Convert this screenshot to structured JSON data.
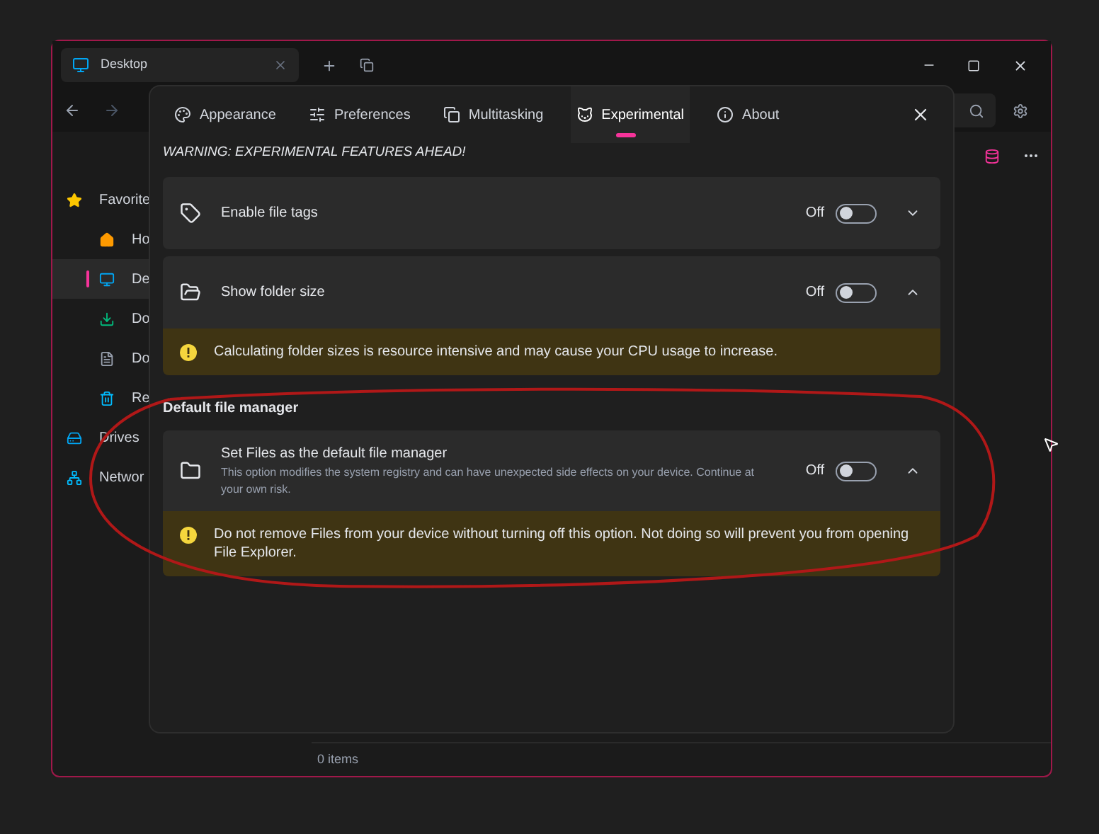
{
  "explorer": {
    "tab": {
      "title": "Desktop"
    },
    "sidebar": {
      "items": [
        {
          "label": "Favorite",
          "selected": false,
          "children": [
            {
              "label": "Ho",
              "selected": false
            },
            {
              "label": "De",
              "selected": true
            },
            {
              "label": "Do",
              "selected": false
            },
            {
              "label": "Do",
              "selected": false
            },
            {
              "label": "Re",
              "selected": false
            }
          ]
        },
        {
          "label": "Drives",
          "selected": false
        },
        {
          "label": "Networ",
          "selected": false
        }
      ]
    },
    "status_bar": "0 items"
  },
  "dialog": {
    "tabs": [
      {
        "label": "Appearance",
        "selected": false
      },
      {
        "label": "Preferences",
        "selected": false
      },
      {
        "label": "Multitasking",
        "selected": false
      },
      {
        "label": "Experimental",
        "selected": true
      },
      {
        "label": "About",
        "selected": false
      }
    ],
    "warning": "WARNING: EXPERIMENTAL FEATURES AHEAD!",
    "sections": [
      {
        "items": [
          {
            "title": "Enable file tags",
            "state_label": "Off",
            "on": false,
            "expanded": false
          },
          {
            "title": "Show folder size",
            "state_label": "Off",
            "on": false,
            "expanded": true,
            "notice": "Calculating folder sizes is resource intensive and may cause your CPU usage to increase."
          }
        ]
      },
      {
        "header": "Default file manager",
        "items": [
          {
            "title": "Set Files as the default file manager",
            "description": "This option modifies the system registry and can have unexpected side effects on your device. Continue at your own risk.",
            "state_label": "Off",
            "on": false,
            "expanded": true,
            "notice": "Do not remove Files from your device without turning off this option. Not doing so will prevent you from opening File Explorer."
          }
        ]
      }
    ]
  }
}
